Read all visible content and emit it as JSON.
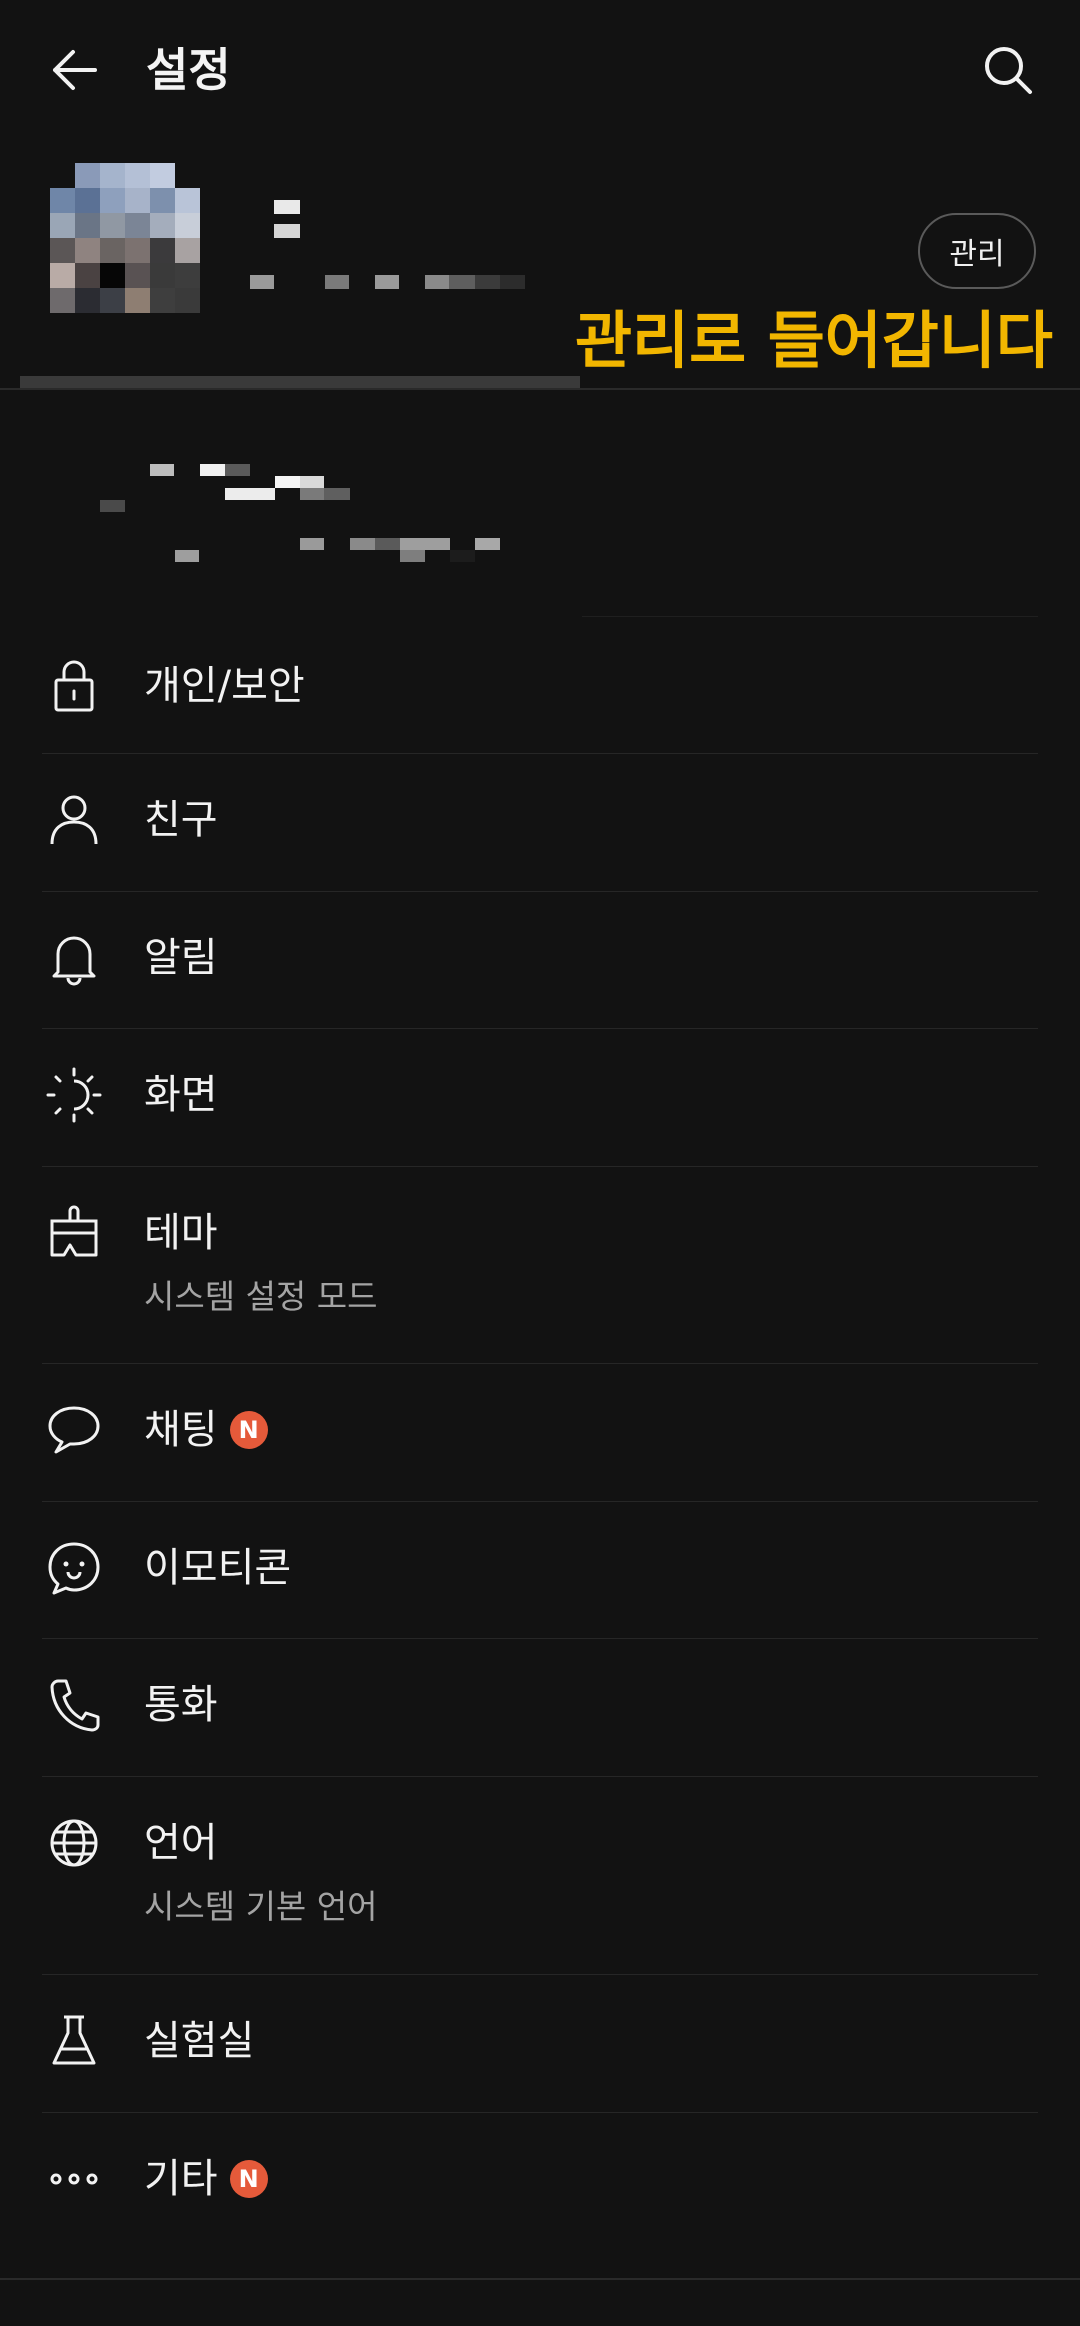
{
  "header": {
    "title": "설정",
    "back_icon": "arrow-left-icon",
    "search_icon": "search-icon"
  },
  "profile": {
    "manage_label": "관리"
  },
  "annotation": {
    "text": "관리로 들어갑니다",
    "color": "#f2b600"
  },
  "menu": {
    "items": [
      {
        "label": "개인/보안",
        "icon": "lock-icon"
      },
      {
        "label": "친구",
        "icon": "person-icon"
      },
      {
        "label": "알림",
        "icon": "bell-icon"
      },
      {
        "label": "화면",
        "icon": "display-icon"
      },
      {
        "label": "테마",
        "icon": "theme-brush-icon",
        "sublabel": "시스템 설정 모드"
      },
      {
        "label": "채팅",
        "icon": "chat-bubble-icon",
        "badge": "N"
      },
      {
        "label": "이모티콘",
        "icon": "emoticon-icon"
      },
      {
        "label": "통화",
        "icon": "phone-icon"
      },
      {
        "label": "언어",
        "icon": "globe-icon",
        "sublabel": "시스템 기본 언어"
      },
      {
        "label": "실험실",
        "icon": "flask-icon"
      },
      {
        "label": "기타",
        "icon": "more-dots-icon",
        "badge": "N"
      }
    ]
  },
  "colors": {
    "background": "#121212",
    "badge": "#e55a3a",
    "text": "#f2f2f2",
    "subtext": "#a4a4a4"
  }
}
